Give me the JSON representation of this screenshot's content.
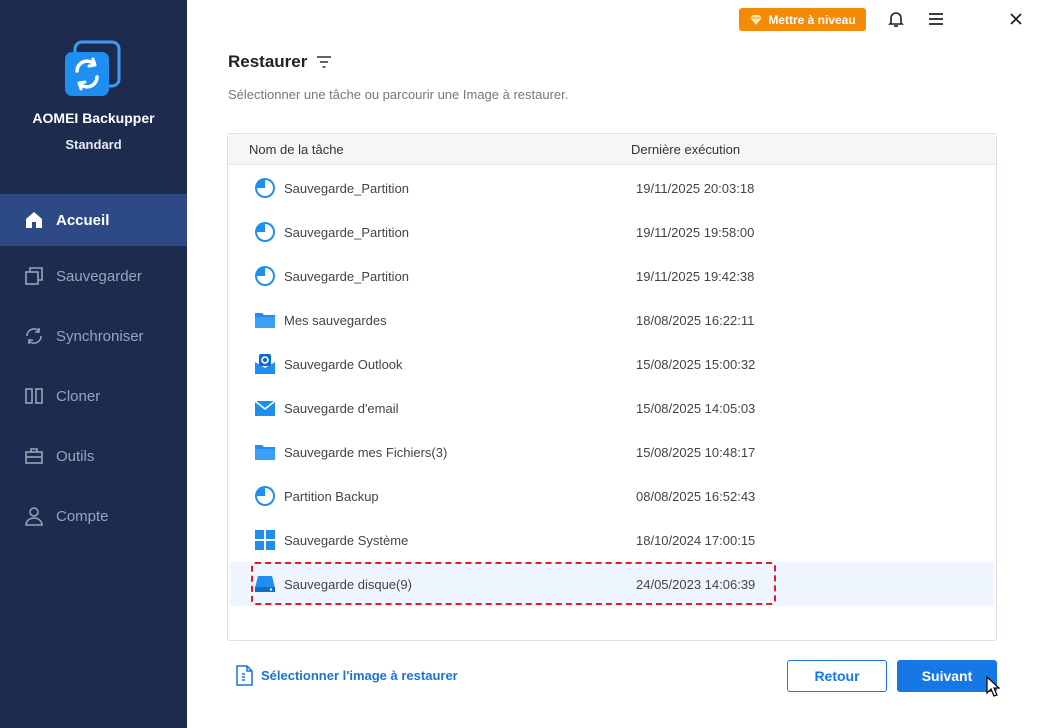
{
  "app": {
    "name": "AOMEI Backupper",
    "edition": "Standard",
    "logo_icon": "aomei-sync-logo-icon"
  },
  "topbar": {
    "upgrade_label": "Mettre à niveau",
    "upgrade_icon": "diamond-icon",
    "icons": [
      "bell-icon",
      "menu-icon",
      "close-icon"
    ]
  },
  "sidebar": {
    "items": [
      {
        "label": "Accueil",
        "icon": "home-icon",
        "active": true
      },
      {
        "label": "Sauvegarder",
        "icon": "backup-icon",
        "active": false
      },
      {
        "label": "Synchroniser",
        "icon": "sync-icon",
        "active": false
      },
      {
        "label": "Cloner",
        "icon": "clone-icon",
        "active": false
      },
      {
        "label": "Outils",
        "icon": "toolbox-icon",
        "active": false
      },
      {
        "label": "Compte",
        "icon": "user-icon",
        "active": false
      }
    ]
  },
  "main": {
    "title": "Restaurer",
    "filter_icon": "filter-icon",
    "subtitle": "Sélectionner une tâche ou parcourir une Image à restaurer.",
    "table": {
      "headers": {
        "name": "Nom de la tâche",
        "date": "Dernière exécution"
      },
      "rows": [
        {
          "name": "Sauvegarde_Partition",
          "date": "19/11/2025 20:03:18",
          "icon": "partition-icon"
        },
        {
          "name": "Sauvegarde_Partition",
          "date": "19/11/2025 19:58:00",
          "icon": "partition-icon"
        },
        {
          "name": "Sauvegarde_Partition",
          "date": "19/11/2025 19:42:38",
          "icon": "partition-icon"
        },
        {
          "name": "Mes sauvegardes",
          "date": "18/08/2025 16:22:11",
          "icon": "folder-icon"
        },
        {
          "name": "Sauvegarde Outlook",
          "date": "15/08/2025 15:00:32",
          "icon": "outlook-icon"
        },
        {
          "name": "Sauvegarde d'email",
          "date": "15/08/2025 14:05:03",
          "icon": "email-icon"
        },
        {
          "name": "Sauvegarde mes Fichiers(3)",
          "date": "15/08/2025 10:48:17",
          "icon": "folder-icon"
        },
        {
          "name": "Partition Backup",
          "date": "08/08/2025 16:52:43",
          "icon": "partition-icon"
        },
        {
          "name": "Sauvegarde Système",
          "date": "18/10/2024 17:00:15",
          "icon": "windows-icon"
        },
        {
          "name": "Sauvegarde disque(9)",
          "date": "24/05/2023 14:06:39",
          "icon": "disk-icon",
          "selected": true
        }
      ]
    },
    "select_image_label": "Sélectionner l'image à restaurer",
    "buttons": {
      "back": "Retour",
      "next": "Suivant"
    }
  },
  "colors": {
    "sidebar_bg": "#1d2b4f",
    "sidebar_active": "#2d4a86",
    "accent": "#1677e5",
    "upgrade": "#f58a07",
    "highlight_border": "#e41b23"
  }
}
